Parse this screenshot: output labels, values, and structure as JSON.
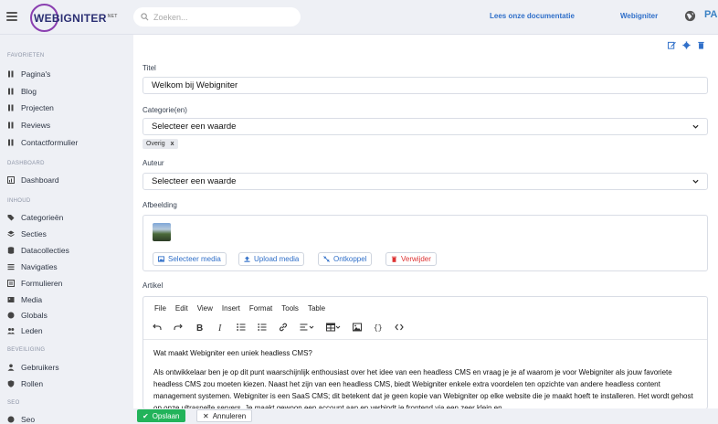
{
  "header": {
    "logo_text": "WEBIGNITER",
    "logo_suffix": "NET",
    "search_placeholder": "Zoeken...",
    "docs_link": "Lees onze documentatie",
    "site_link": "Webigniter",
    "user_initials": "PA"
  },
  "sidebar": {
    "sections": [
      {
        "title": "FAVORIETEN",
        "items": [
          {
            "label": "Pagina's",
            "icon": "pages-icon"
          },
          {
            "label": "Blog",
            "icon": "blog-icon"
          },
          {
            "label": "Projecten",
            "icon": "projects-icon"
          },
          {
            "label": "Reviews",
            "icon": "reviews-icon"
          },
          {
            "label": "Contactformulier",
            "icon": "contact-form-icon"
          }
        ]
      },
      {
        "title": "DASHBOARD",
        "items": [
          {
            "label": "Dashboard",
            "icon": "dashboard-icon"
          }
        ]
      },
      {
        "title": "INHOUD",
        "items": [
          {
            "label": "Categorieën",
            "icon": "categories-icon"
          },
          {
            "label": "Secties",
            "icon": "sections-icon"
          },
          {
            "label": "Datacollecties",
            "icon": "database-icon"
          },
          {
            "label": "Navigaties",
            "icon": "navigation-icon"
          },
          {
            "label": "Formulieren",
            "icon": "forms-icon"
          },
          {
            "label": "Media",
            "icon": "media-icon"
          },
          {
            "label": "Globals",
            "icon": "globe-icon"
          },
          {
            "label": "Leden",
            "icon": "members-icon"
          }
        ]
      },
      {
        "title": "BEVEILIGING",
        "items": [
          {
            "label": "Gebruikers",
            "icon": "users-icon"
          },
          {
            "label": "Rollen",
            "icon": "roles-icon"
          }
        ]
      },
      {
        "title": "SEO",
        "items": [
          {
            "label": "Seo",
            "icon": "seo-icon"
          }
        ]
      }
    ]
  },
  "form": {
    "title_label": "Titel",
    "title_value": "Welkom bij Webigniter",
    "category_label": "Categorie(en)",
    "category_placeholder": "Selecteer een waarde",
    "category_tag": "Overig",
    "author_label": "Auteur",
    "author_placeholder": "Selecteer een waarde",
    "image_label": "Afbeelding",
    "media_buttons": [
      "Selecteer media",
      "Upload media",
      "Ontkoppel",
      "Verwijder"
    ],
    "article_label": "Artikel"
  },
  "editor": {
    "menu": [
      "File",
      "Edit",
      "View",
      "Insert",
      "Format",
      "Tools",
      "Table"
    ],
    "heading": "Wat maakt Webigniter een uniek headless CMS?",
    "paragraph": "Als ontwikkelaar ben je op dit punt waarschijnlijk enthousiast over het idee van een headless CMS en vraag je je af waarom je voor Webigniter als jouw favoriete headless CMS zou moeten kiezen. Naast het zijn van een headless CMS, biedt Webigniter enkele extra voordelen ten opzichte van andere headless content management systemen. Webigniter is een SaaS CMS; dit betekent dat je geen kopie van Webigniter op elke website die je maakt hoeft te installeren. Het wordt gehost op onze ultrasnelle servers. Je maakt gewoon een account aan en verbindt je frontend via een zeer klein en"
  },
  "footer": {
    "save_label": "Opslaan",
    "cancel_label": "Annuleren"
  },
  "colors": {
    "accent": "#2f6fc9",
    "save_green": "#22b35a",
    "danger": "#d33333"
  }
}
